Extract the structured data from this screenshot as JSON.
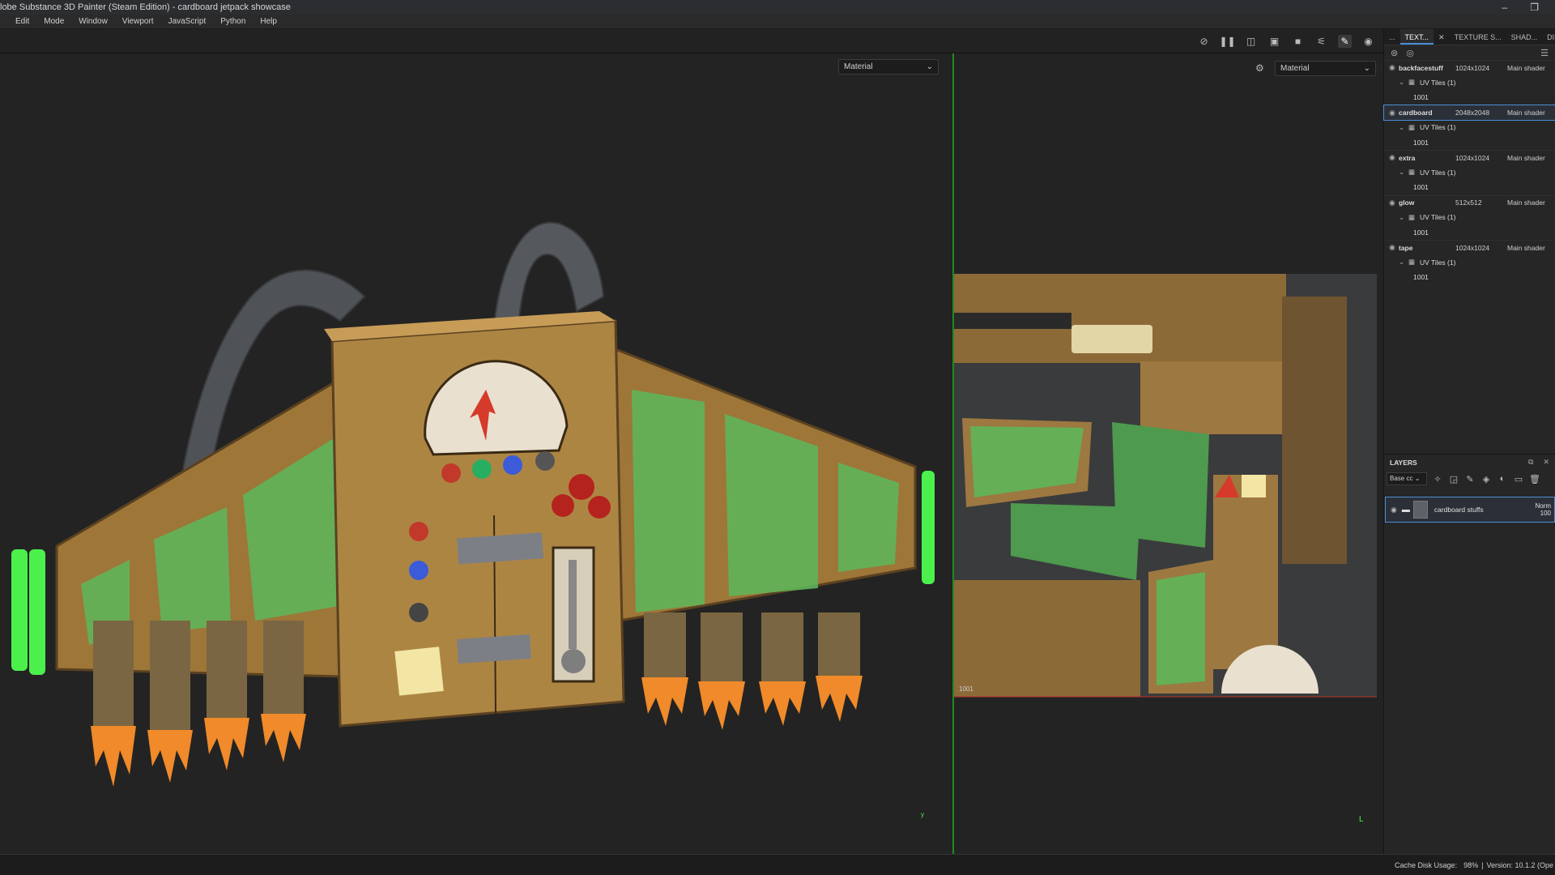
{
  "window": {
    "title": "lobe Substance 3D Painter (Steam Edition) - cardboard jetpack showcase",
    "minimize": "–",
    "restore": "❐"
  },
  "menu": [
    "Edit",
    "Mode",
    "Window",
    "Viewport",
    "JavaScript",
    "Python",
    "Help"
  ],
  "viewport3d": {
    "channel_select": "Material",
    "axis_label": "y"
  },
  "viewport2d": {
    "channel_select": "Material",
    "udim_label": "1001"
  },
  "texture_set_panel": {
    "tabs": [
      {
        "label": "...",
        "active": false
      },
      {
        "label": "TEXT...",
        "active": true
      },
      {
        "label": "TEXTURE S...",
        "active": false
      },
      {
        "label": "SHAD...",
        "active": false
      },
      {
        "label": "DISPL...",
        "active": false
      }
    ],
    "sets": [
      {
        "name": "backfacestuff",
        "resolution": "1024x1024",
        "shader": "Main shader",
        "tiles": "UV Tiles (1)",
        "udim": "1001",
        "selected": false
      },
      {
        "name": "cardboard",
        "resolution": "2048x2048",
        "shader": "Main shader",
        "tiles": "UV Tiles (1)",
        "udim": "1001",
        "selected": true
      },
      {
        "name": "extra",
        "resolution": "1024x1024",
        "shader": "Main shader",
        "tiles": "UV Tiles (1)",
        "udim": "1001",
        "selected": false
      },
      {
        "name": "glow",
        "resolution": "512x512",
        "shader": "Main shader",
        "tiles": "UV Tiles (1)",
        "udim": "1001",
        "selected": false
      },
      {
        "name": "tape",
        "resolution": "1024x1024",
        "shader": "Main shader",
        "tiles": "UV Tiles (1)",
        "udim": "1001",
        "selected": false
      }
    ]
  },
  "layers_panel": {
    "title": "LAYERS",
    "channel": "Base cc",
    "layer": {
      "name": "cardboard stuffs",
      "blend": "Norm",
      "opacity": "100"
    }
  },
  "status": {
    "cache": "Cache Disk Usage:",
    "cache_value": "98%",
    "version": "Version: 10.1.2 (Ope"
  },
  "colors": {
    "accent": "#4a8ed8",
    "split_line": "#1f8a1f",
    "cardboard": "#a0793c",
    "paint_green": "#5cb85c",
    "flame_orange": "#f08a2a"
  }
}
